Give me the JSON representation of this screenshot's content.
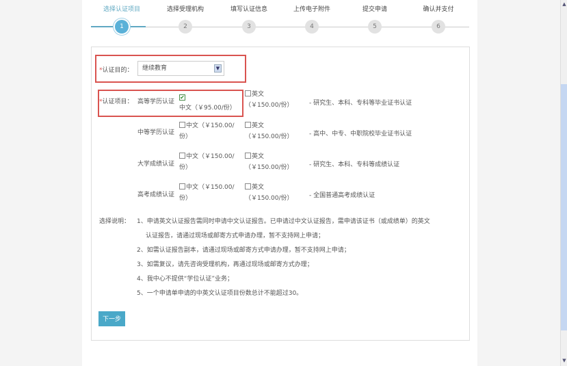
{
  "steps": [
    {
      "label": "选择认证项目",
      "num": "1"
    },
    {
      "label": "选择受理机构",
      "num": "2"
    },
    {
      "label": "填写认证信息",
      "num": "3"
    },
    {
      "label": "上传电子附件",
      "num": "4"
    },
    {
      "label": "提交申请",
      "num": "5"
    },
    {
      "label": "确认并支付",
      "num": "6"
    }
  ],
  "purpose": {
    "star": "*",
    "label": "认证目的：",
    "value": "继续教育"
  },
  "items": {
    "star": "*",
    "label": "认证项目：",
    "rows": [
      {
        "name": "高等学历认证",
        "zh": "中文（￥95.00/份）",
        "zh_checked": true,
        "en": "英文（￥150.00/份）",
        "desc": "- 研究生、本科、专科等毕业证书认证"
      },
      {
        "name": "中等学历认证",
        "zh": "中文（￥150.00/份）",
        "zh_checked": false,
        "en": "英文（￥150.00/份）",
        "desc": "- 高中、中专、中职院校毕业证书认证"
      },
      {
        "name": "大学成绩认证",
        "zh": "中文（￥150.00/份）",
        "zh_checked": false,
        "en": "英文（￥150.00/份）",
        "desc": "- 研究生、本科、专科等成绩认证"
      },
      {
        "name": "高考成绩认证",
        "zh": "中文（￥150.00/份）",
        "zh_checked": false,
        "en": "英文（￥150.00/份）",
        "desc": "- 全国普通高考成绩认证"
      }
    ]
  },
  "notes": {
    "label": "选择说明：",
    "lines": [
      "1、申请英文认证报告需同时申请中文认证报告。已申请过中文认证报告，需申请该证书（或成绩单）的英文",
      "认证报告，请通过现场或邮寄方式申请办理，暂不支持网上申请；",
      "2、如需认证报告副本，请通过现场或邮寄方式申请办理，暂不支持网上申请；",
      "3、如需复议，请先咨询受理机构，再通过现场或邮寄方式办理；",
      "4、我中心不提供“学位认证”业务；",
      "5、一个申请单申请的中英文认证项目份数总计不能超过30。"
    ]
  },
  "next_button": "下一步"
}
